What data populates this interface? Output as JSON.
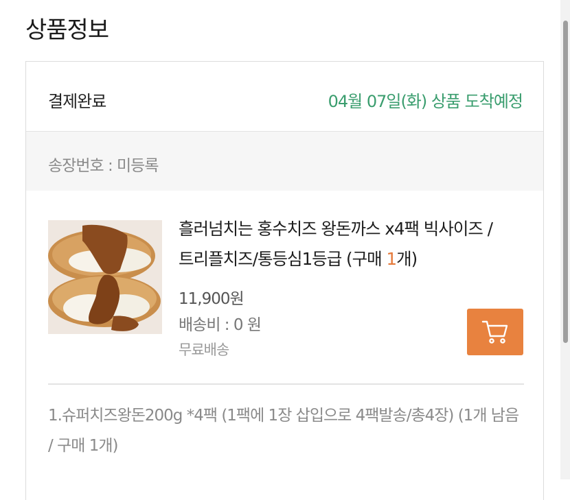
{
  "page": {
    "section_title": "상품정보"
  },
  "order": {
    "status": "결제완료",
    "arrival": "04월 07일(화) 상품 도착예정",
    "invoice": "송장번호 : 미등록"
  },
  "product": {
    "name": "흘러넘치는 홍수치즈 왕돈까스 x4팩 빅사이즈 / 트리플치즈/통등심1등급",
    "qty_prefix": " (구매 ",
    "qty": "1",
    "qty_suffix": "개)",
    "price": "11,900원",
    "shipping": "배송비 : 0 원",
    "shipping_type": "무료배송",
    "image_icon": "tonkatsu-photo",
    "cart_icon": "cart-icon"
  },
  "option": {
    "text": "1.슈퍼치즈왕돈200g *4팩 (1팩에 1장 삽입으로 4팩발송/총4장) (1개 남음 / 구매 1개)"
  },
  "colors": {
    "accent_green": "#3a9d6e",
    "accent_orange": "#e8823f",
    "qty_orange": "#e57a3b"
  }
}
